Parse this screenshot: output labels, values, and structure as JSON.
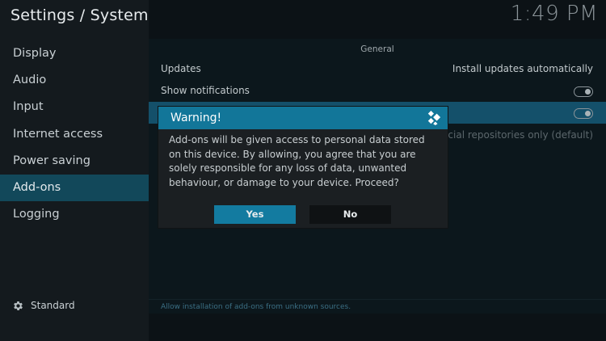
{
  "header": {
    "title": "Settings / System",
    "clock": "1:49 PM"
  },
  "sidebar": {
    "items": [
      {
        "label": "Display"
      },
      {
        "label": "Audio"
      },
      {
        "label": "Input"
      },
      {
        "label": "Internet access"
      },
      {
        "label": "Power saving"
      },
      {
        "label": "Add-ons",
        "selected": true
      },
      {
        "label": "Logging"
      }
    ],
    "settings_level": "Standard"
  },
  "main": {
    "section_title": "General",
    "rows": [
      {
        "label": "Updates",
        "value": "Install updates automatically"
      },
      {
        "label": "Show notifications",
        "toggle": "off"
      },
      {
        "label": "",
        "toggle": "off"
      },
      {
        "label": "",
        "value": "Official repositories only (default)"
      }
    ],
    "help_text": "Allow installation of add-ons from unknown sources."
  },
  "dialog": {
    "title": "Warning!",
    "message": "Add-ons will be given access to personal data stored on this device. By allowing, you agree that you are solely responsible for any loss of data, unwanted behaviour, or damage to your device. Proceed?",
    "yes_label": "Yes",
    "no_label": "No"
  },
  "colors": {
    "accent": "#127699",
    "selected": "#12485a",
    "background": "#0c1216"
  }
}
